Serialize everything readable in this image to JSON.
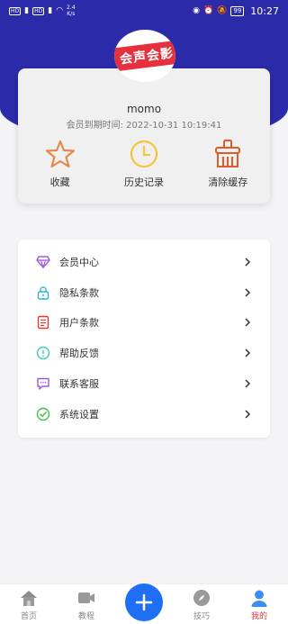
{
  "status_bar": {
    "left_badges": [
      "HD",
      "HD"
    ],
    "net_speed": "2.4",
    "net_unit": "K/s",
    "battery": "99",
    "time": "10:27"
  },
  "logo": {
    "text": "会声会影"
  },
  "profile": {
    "username": "momo",
    "expire_label": "会员到期时间: ",
    "expire_value": "2022-10-31 10:19:41"
  },
  "quick_actions": [
    {
      "label": "收藏",
      "icon": "star-icon",
      "color": "#e8884f"
    },
    {
      "label": "历史记录",
      "icon": "clock-icon",
      "color": "#f3c53c"
    },
    {
      "label": "清除缓存",
      "icon": "broom-icon",
      "color": "#e05a2b"
    }
  ],
  "menu": [
    {
      "label": "会员中心",
      "icon": "diamond-icon",
      "color": "#a259e0"
    },
    {
      "label": "隐私条款",
      "icon": "lock-icon",
      "color": "#2fb7d8"
    },
    {
      "label": "用户条款",
      "icon": "document-icon",
      "color": "#e53935"
    },
    {
      "label": "帮助反馈",
      "icon": "help-icon",
      "color": "#3ecfb0"
    },
    {
      "label": "联系客服",
      "icon": "chat-icon",
      "color": "#9b59e0"
    },
    {
      "label": "系统设置",
      "icon": "check-circle-icon",
      "color": "#43c043"
    }
  ],
  "nav": [
    {
      "label": "首页",
      "icon": "home-icon"
    },
    {
      "label": "教程",
      "icon": "video-icon"
    },
    {
      "label": "",
      "icon": "plus-icon"
    },
    {
      "label": "技巧",
      "icon": "compass-icon"
    },
    {
      "label": "我的",
      "icon": "user-icon",
      "active": true
    }
  ],
  "colors": {
    "header": "#2b2aa8",
    "accent_red": "#e53935",
    "plus_blue": "#1f6ff5"
  }
}
